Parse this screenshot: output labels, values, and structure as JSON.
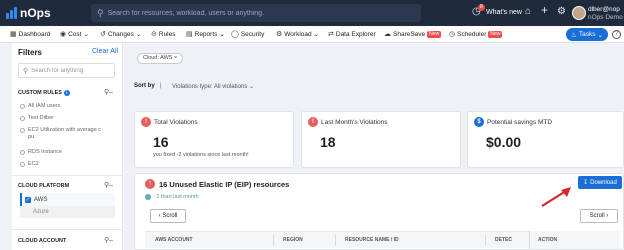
{
  "header": {
    "logo": "nOps",
    "search_placeholder": "Search for resources, workload, users or anything.",
    "notification_count": "8",
    "whats_new": "What's new",
    "user_name": "dlber@nop",
    "user_org": "nOps Demo"
  },
  "nav": {
    "items": [
      {
        "label": "Dashboard",
        "icon": "grid-icon"
      },
      {
        "label": "Cost",
        "icon": "dollar-icon"
      },
      {
        "label": "Changes",
        "icon": "changes-icon"
      },
      {
        "label": "Rules",
        "icon": "rules-icon"
      },
      {
        "label": "Reports",
        "icon": "reports-icon"
      },
      {
        "label": "Security",
        "icon": "shield-icon"
      },
      {
        "label": "Workload",
        "icon": "gear-icon"
      },
      {
        "label": "Data Explorer",
        "icon": "explorer-icon"
      },
      {
        "label": "ShareSave",
        "icon": "cloud-icon"
      },
      {
        "label": "Scheduler",
        "icon": "clock-icon"
      }
    ],
    "new_label": "New",
    "tasks_label": "Tasks"
  },
  "filters": {
    "title": "Filters",
    "clear_all": "Clear All",
    "search_placeholder": "Search for anything",
    "custom_rules_label": "CUSTOM RULES",
    "custom_rules_count": "i",
    "custom_rules": [
      "All IAM users",
      "Test Dilber",
      "EC2 Utilization with average c pu",
      "RDS Instance",
      "EC2"
    ],
    "cloud_platform_label": "CLOUD PLATFORM",
    "cloud_platform_options": [
      "AWS",
      "Azure"
    ],
    "cloud_account_label": "CLOUD ACCOUNT"
  },
  "main": {
    "chip": "Cloud: AWS",
    "sort_by": "Sort by",
    "violations_type": "Violations type: All violations",
    "cards": [
      {
        "title": "Total Violations",
        "value": "16",
        "sub": "you fixed -2 violations since last month!",
        "color": "#e85c5c",
        "icon": "!"
      },
      {
        "title": "Last Month's Violations",
        "value": "18",
        "sub": "",
        "color": "#e85c5c",
        "icon": "!"
      },
      {
        "title": "Potential savings MTD",
        "value": "$0.00",
        "sub": "",
        "color": "#1a6ed8",
        "icon": "$"
      }
    ],
    "panel": {
      "title": "16 Unused Elastic IP (EIP) resources",
      "trend": "- 2 than last month",
      "download": "Download",
      "scroll_left": "Scroll",
      "scroll_right": "Scroll",
      "columns": [
        "AWS ACCOUNT",
        "REGION",
        "RESOURCE NAME / ID",
        "DETEC",
        "ACTION"
      ]
    }
  }
}
